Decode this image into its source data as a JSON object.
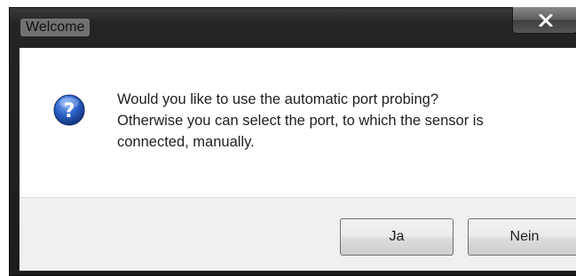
{
  "window": {
    "title": "Welcome",
    "close_icon": "close-icon"
  },
  "dialog": {
    "icon": "question-icon",
    "message_lines": [
      "Would you like to use the automatic port probing?",
      "Otherwise you can select the port, to which the sensor is",
      "connected, manually."
    ]
  },
  "buttons": {
    "yes_label": "Ja",
    "no_label": "Nein"
  },
  "colors": {
    "icon_blue": "#2a5fc4",
    "frame_dark": "#1c1c1c",
    "footer_bg": "#f0f0f0"
  }
}
